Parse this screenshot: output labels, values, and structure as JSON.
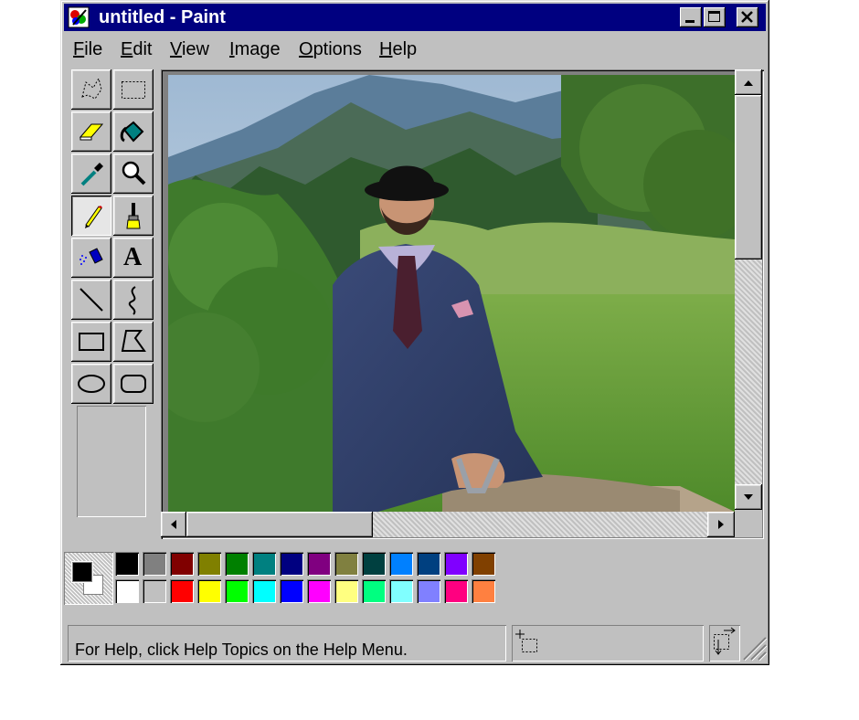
{
  "window": {
    "title": "untitled - Paint",
    "icon": "paint-app-icon",
    "controls": [
      "minimize-icon",
      "maximize-icon",
      "close-icon"
    ]
  },
  "menubar": {
    "items": [
      {
        "label": "File",
        "mnemonic": "F",
        "rest": "ile"
      },
      {
        "label": "Edit",
        "mnemonic": "E",
        "rest": "dit"
      },
      {
        "label": "View",
        "mnemonic": "V",
        "rest": "iew"
      },
      {
        "label": "Image",
        "mnemonic": "I",
        "rest": "mage"
      },
      {
        "label": "Options",
        "mnemonic": "O",
        "rest": "ptions"
      },
      {
        "label": "Help",
        "mnemonic": "H",
        "rest": "elp"
      }
    ]
  },
  "toolbox": {
    "tools": [
      {
        "name": "free-form-select-icon"
      },
      {
        "name": "select-icon"
      },
      {
        "name": "eraser-icon"
      },
      {
        "name": "fill-with-color-icon"
      },
      {
        "name": "pick-color-icon"
      },
      {
        "name": "magnifier-icon"
      },
      {
        "name": "pencil-icon",
        "selected": true
      },
      {
        "name": "brush-icon"
      },
      {
        "name": "airbrush-icon"
      },
      {
        "name": "text-icon",
        "glyph": "A"
      },
      {
        "name": "line-icon"
      },
      {
        "name": "curve-icon"
      },
      {
        "name": "rectangle-icon"
      },
      {
        "name": "polygon-icon"
      },
      {
        "name": "ellipse-icon"
      },
      {
        "name": "rounded-rectangle-icon"
      }
    ]
  },
  "canvas": {
    "content": "photo"
  },
  "palette": {
    "foreground": "#000000",
    "background": "#ffffff",
    "top_row": [
      "#000000",
      "#808080",
      "#800000",
      "#808000",
      "#008000",
      "#008080",
      "#000080",
      "#800080",
      "#808040",
      "#004040",
      "#0080ff",
      "#004080",
      "#8000ff",
      "#804000"
    ],
    "bottom_row": [
      "#ffffff",
      "#c0c0c0",
      "#ff0000",
      "#ffff00",
      "#00ff00",
      "#00ffff",
      "#0000ff",
      "#ff00ff",
      "#ffff80",
      "#00ff80",
      "#80ffff",
      "#8080ff",
      "#ff0080",
      "#ff8040"
    ]
  },
  "statusbar": {
    "help_text": "For Help, click Help Topics on the Help Menu.",
    "position_icon": "cursor-position-icon",
    "size_icon": "selection-size-icon"
  }
}
